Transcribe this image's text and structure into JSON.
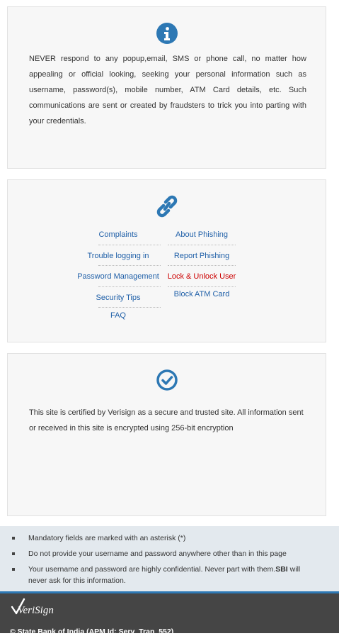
{
  "security_notice": {
    "icon": "info-icon",
    "text": "NEVER respond to any popup,email, SMS or phone call, no matter how appealing or official looking, seeking your personal information such as username, password(s), mobile number, ATM Card details, etc. Such communications are sent or created by fraudsters to trick you into parting with your credentials."
  },
  "quick_links": {
    "icon": "link-icon",
    "left": [
      "Complaints",
      "Trouble logging in",
      "Password Management",
      "Security Tips",
      "FAQ"
    ],
    "right": [
      "About Phishing",
      "Report Phishing",
      "Lock & Unlock User",
      "Block ATM Card"
    ],
    "highlight_color": "#cc0000",
    "link_color": "#2060a8"
  },
  "verisign_notice": {
    "icon": "check-circle-icon",
    "text": "This site is certified by Verisign as a secure and trusted site. All information sent or received in this site is encrypted using 256-bit encryption"
  },
  "notes": {
    "items": [
      "Mandatory fields are marked with an asterisk (*)",
      "Do not provide your username and password anywhere other than in this page"
    ],
    "item3_text": "Your username and password are highly confidential. Never part with them.",
    "item3_bold": "SBI",
    "item3_tail": " will never ask for this information."
  },
  "footer": {
    "logo_text": "VeriSign",
    "copyright": "© State Bank of India (APM Id: Serv_Tran_552)"
  },
  "colors": {
    "accent_blue": "#2d78b4",
    "footer_bg": "#454545",
    "notes_bg": "#e3e9ee"
  }
}
